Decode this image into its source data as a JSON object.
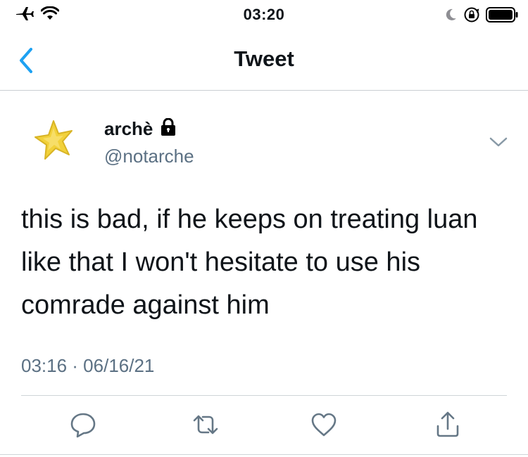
{
  "status_bar": {
    "time": "03:20",
    "icons": [
      "airplane-icon",
      "wifi-icon",
      "moon-icon",
      "rotation-lock-icon",
      "battery-icon"
    ]
  },
  "nav": {
    "title": "Tweet",
    "back_icon": "chevron-left-icon"
  },
  "tweet": {
    "author_name": "archè",
    "author_handle": "@notarche",
    "protected_icon": "lock-icon",
    "avatar_icon": "star-avatar",
    "text": "this is bad, if he keeps on treating luan like that I won't hesitate to use his comrade against him",
    "timestamp": "03:16 · 06/16/21"
  },
  "actions": [
    "reply-icon",
    "retweet-icon",
    "like-icon",
    "share-icon"
  ],
  "colors": {
    "accent": "#1da1f2",
    "secondary_text": "#5b7083",
    "icon_gray": "#657786"
  }
}
